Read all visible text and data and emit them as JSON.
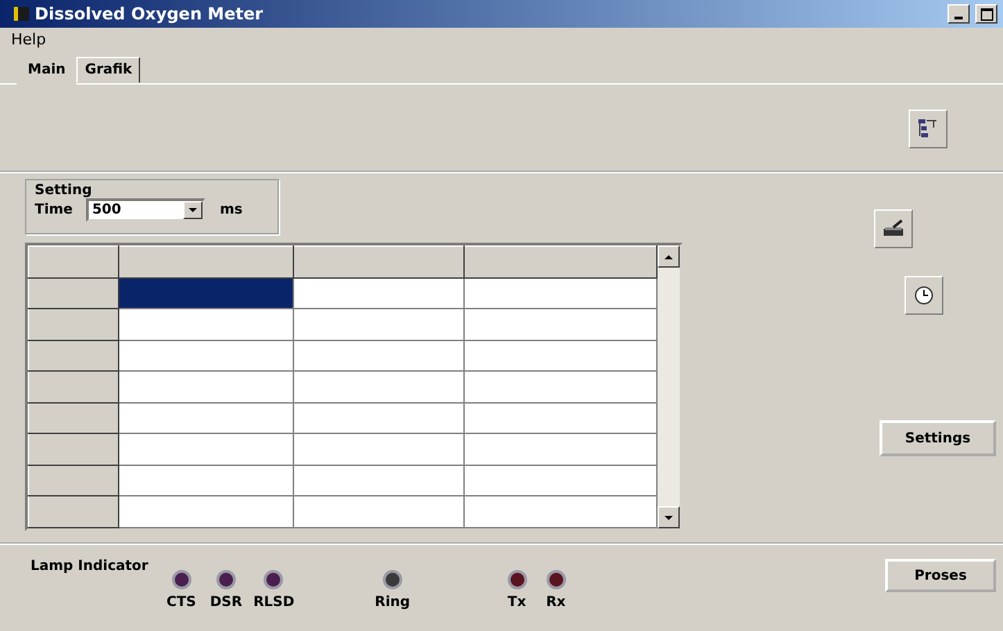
{
  "window": {
    "title": "Dissolved Oxygen Meter"
  },
  "menu": [
    "Help"
  ],
  "tabs": [
    {
      "label": "Main",
      "selected": true
    },
    {
      "label": "Grafik",
      "selected": false
    }
  ],
  "setting": {
    "title": "Setting",
    "label": "Time",
    "value": "500",
    "unit": "ms"
  },
  "table": {
    "rows": [
      {
        "cells": [
          {
            "selected": true
          },
          {
            "selected": false
          },
          {
            "selected": false
          }
        ]
      },
      {
        "cells": [
          {
            "selected": false
          },
          {
            "selected": false
          },
          {
            "selected": false
          }
        ]
      },
      {
        "cells": [
          {
            "selected": false
          },
          {
            "selected": false
          },
          {
            "selected": false
          }
        ]
      },
      {
        "cells": [
          {
            "selected": false
          },
          {
            "selected": false
          },
          {
            "selected": false
          }
        ]
      },
      {
        "cells": [
          {
            "selected": false
          },
          {
            "selected": false
          },
          {
            "selected": false
          }
        ]
      },
      {
        "cells": [
          {
            "selected": false
          },
          {
            "selected": false
          },
          {
            "selected": false
          }
        ]
      },
      {
        "cells": [
          {
            "selected": false
          },
          {
            "selected": false
          },
          {
            "selected": false
          }
        ]
      },
      {
        "cells": [
          {
            "selected": false
          },
          {
            "selected": false
          },
          {
            "selected": false
          }
        ]
      }
    ]
  },
  "settings_button": "Settings",
  "lamps": {
    "title": "Lamp Indicator",
    "items": [
      {
        "label": "CTS",
        "color": "#4a1f4e"
      },
      {
        "label": "DSR",
        "color": "#4a1f4e"
      },
      {
        "label": "RLSD",
        "color": "#4a1f4e"
      },
      {
        "label": "Ring",
        "color": "#3a3a3a"
      },
      {
        "label": "Tx",
        "color": "#5a1420"
      },
      {
        "label": "Rx",
        "color": "#5a1420"
      }
    ]
  },
  "proses_button": "Proses"
}
